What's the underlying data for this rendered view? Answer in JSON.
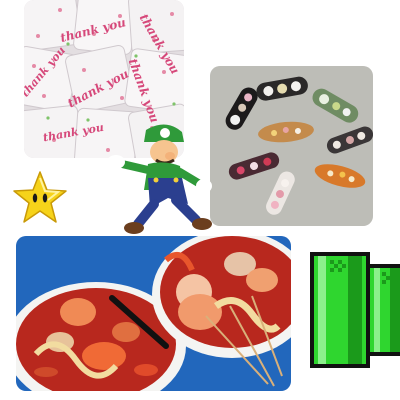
{
  "collage": {
    "photos": [
      {
        "subject": "thank-you-candy-wrappers",
        "wrapper_text": "thank you"
      },
      {
        "subject": "decorated-hair-clips"
      },
      {
        "subject": "hot-pot-soup-bowls"
      }
    ],
    "stickers": [
      {
        "subject": "luigi"
      },
      {
        "subject": "super-star"
      },
      {
        "subject": "green-pipe"
      }
    ],
    "colors": {
      "candy_pink": "#d6487a",
      "clip_background": "#b9b8b3",
      "soup_blue": "#1f63b8",
      "broth_red": "#b8281e",
      "luigi_green": "#2f9a3a",
      "star_yellow": "#f6d31a",
      "pipe_green": "#2fd62f"
    }
  }
}
